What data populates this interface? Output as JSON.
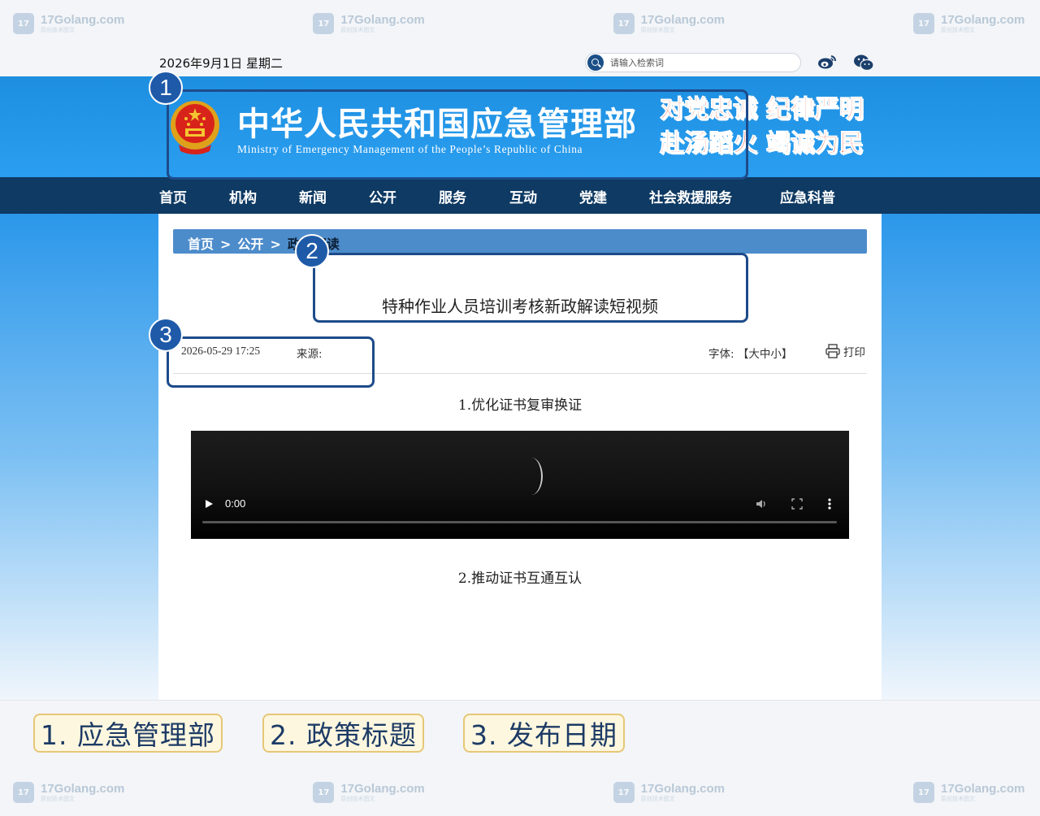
{
  "watermark": {
    "name": "17Golang.com",
    "sub": "原创技术图文",
    "logo": "17"
  },
  "topbar": {
    "date": "2026年9月1日 星期二",
    "search_placeholder": "请输入检索词"
  },
  "header": {
    "title": "中华人民共和国应急管理部",
    "subtitle": "Ministry of Emergency Management of the People’s Republic of China",
    "slogan_line1": "对党忠诚 纪律严明",
    "slogan_line2": "赴汤蹈火 竭诚为民"
  },
  "nav": [
    "首页",
    "机构",
    "新闻",
    "公开",
    "服务",
    "互动",
    "党建",
    "社会救援服务",
    "应急科普"
  ],
  "breadcrumb": {
    "home": "首页",
    "sep": ">",
    "open": "公开",
    "current": "政策解读"
  },
  "article": {
    "title": "特种作业人员培训考核新政解读短视频",
    "date": "2026-05-29 17:25",
    "source_label": "来源:",
    "font_label": "字体:",
    "font_options": "【大中小】",
    "print_label": "打印",
    "section1": "1.优化证书复审换证",
    "section2": "2.推动证书互通互认",
    "video_time": "0:00",
    "video_progress": 0
  },
  "annotations": [
    {
      "num": "1",
      "label": "1. 应急管理部"
    },
    {
      "num": "2",
      "label": "2. 政策标题"
    },
    {
      "num": "3",
      "label": "3. 发布日期"
    }
  ],
  "colors": {
    "banner": "#1e8fe0",
    "nav": "#0e3a63",
    "breadcrumb": "#4d8ccb",
    "slogan": "#e83a18",
    "annotation": "#1e5aa8"
  }
}
